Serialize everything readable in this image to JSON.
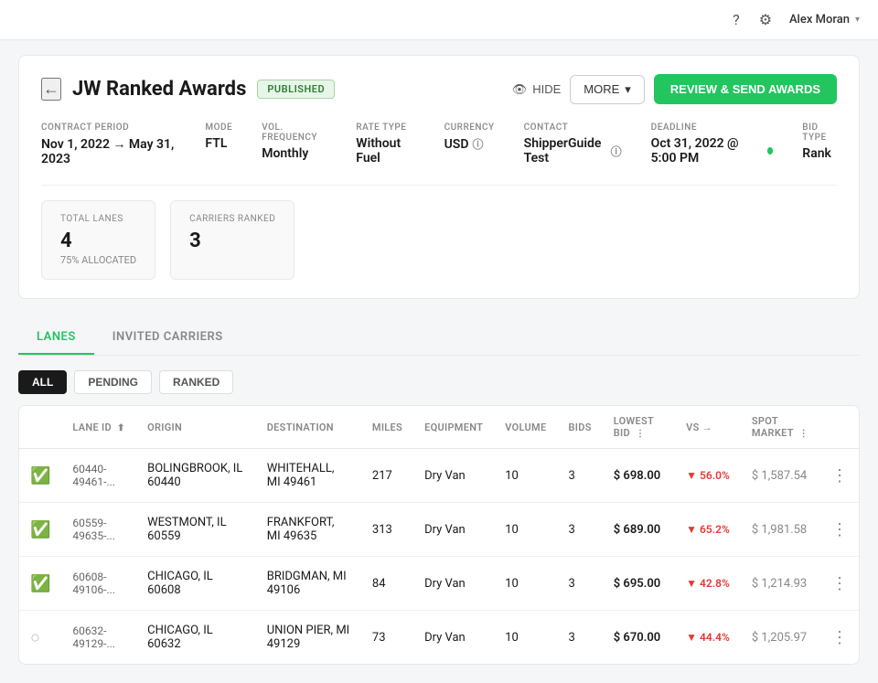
{
  "nav": {
    "help_icon": "?",
    "settings_icon": "⚙",
    "user_name": "Alex Moran",
    "chevron": "▾"
  },
  "header": {
    "back_label": "←",
    "title": "JW Ranked Awards",
    "badge": "PUBLISHED",
    "hide_label": "HIDE",
    "more_label": "MORE",
    "review_label": "REVIEW & SEND AWARDS"
  },
  "meta": [
    {
      "label": "CONTRACT PERIOD",
      "value": "Nov 1, 2022 → May 31, 2023",
      "extra": ""
    },
    {
      "label": "MODE",
      "value": "FTL",
      "extra": ""
    },
    {
      "label": "VOL. FREQUENCY",
      "value": "Monthly",
      "extra": ""
    },
    {
      "label": "RATE TYPE",
      "value": "Without Fuel",
      "extra": ""
    },
    {
      "label": "CURRENCY",
      "value": "USD",
      "extra": "info"
    },
    {
      "label": "CONTACT",
      "value": "ShipperGuide Test",
      "extra": "info"
    },
    {
      "label": "DEADLINE",
      "value": "Oct 31, 2022 @ 5:00 PM",
      "extra": "dot"
    },
    {
      "label": "BID TYPE",
      "value": "Rank",
      "extra": ""
    }
  ],
  "stats": [
    {
      "label": "TOTAL LANES",
      "value": "4",
      "sub": "75% ALLOCATED"
    },
    {
      "label": "CARRIERS RANKED",
      "value": "3",
      "sub": ""
    }
  ],
  "tabs": [
    {
      "label": "LANES",
      "active": true
    },
    {
      "label": "INVITED CARRIERS",
      "active": false
    }
  ],
  "filters": [
    {
      "label": "ALL",
      "active": true
    },
    {
      "label": "PENDING",
      "active": false
    },
    {
      "label": "RANKED",
      "active": false
    }
  ],
  "table": {
    "columns": [
      {
        "key": "status",
        "label": ""
      },
      {
        "key": "lane_id",
        "label": "LANE ID",
        "sortable": true
      },
      {
        "key": "origin",
        "label": "ORIGIN"
      },
      {
        "key": "destination",
        "label": "DESTINATION"
      },
      {
        "key": "miles",
        "label": "MILES"
      },
      {
        "key": "equipment",
        "label": "EQUIPMENT"
      },
      {
        "key": "volume",
        "label": "VOLUME"
      },
      {
        "key": "bids",
        "label": "BIDS"
      },
      {
        "key": "lowest_bid",
        "label": "LOWEST BID",
        "sortable": true
      },
      {
        "key": "vs",
        "label": "VS →"
      },
      {
        "key": "spot_market",
        "label": "SPOT MARKET",
        "sortable": true
      },
      {
        "key": "menu",
        "label": ""
      }
    ],
    "rows": [
      {
        "status": "ranked",
        "lane_id": "60440-49461-...",
        "origin": "BOLINGBROOK, IL 60440",
        "destination": "WHITEHALL, MI 49461",
        "miles": "217",
        "equipment": "Dry Van",
        "volume": "10",
        "bids": "3",
        "lowest_bid": "$ 698.00",
        "vs_pct": "56.0%",
        "vs_dir": "down",
        "spot_market": "$ 1,587.54"
      },
      {
        "status": "ranked",
        "lane_id": "60559-49635-...",
        "origin": "WESTMONT, IL 60559",
        "destination": "FRANKFORT, MI 49635",
        "miles": "313",
        "equipment": "Dry Van",
        "volume": "10",
        "bids": "3",
        "lowest_bid": "$ 689.00",
        "vs_pct": "65.2%",
        "vs_dir": "down",
        "spot_market": "$ 1,981.58"
      },
      {
        "status": "ranked",
        "lane_id": "60608-49106-...",
        "origin": "CHICAGO, IL 60608",
        "destination": "BRIDGMAN, MI 49106",
        "miles": "84",
        "equipment": "Dry Van",
        "volume": "10",
        "bids": "3",
        "lowest_bid": "$ 695.00",
        "vs_pct": "42.8%",
        "vs_dir": "down",
        "spot_market": "$ 1,214.93"
      },
      {
        "status": "pending",
        "lane_id": "60632-49129-...",
        "origin": "CHICAGO, IL 60632",
        "destination": "UNION PIER, MI 49129",
        "miles": "73",
        "equipment": "Dry Van",
        "volume": "10",
        "bids": "3",
        "lowest_bid": "$ 670.00",
        "vs_pct": "44.4%",
        "vs_dir": "down",
        "spot_market": "$ 1,205.97"
      }
    ]
  }
}
